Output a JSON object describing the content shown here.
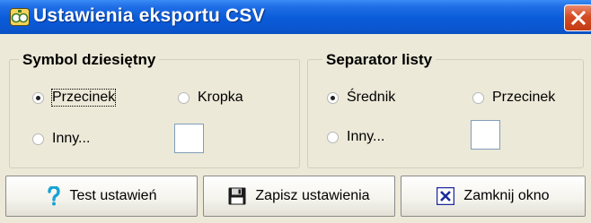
{
  "window": {
    "title": "Ustawienia eksportu CSV"
  },
  "decimal_group": {
    "legend": "Symbol dziesiętny",
    "options": [
      "Przecinek",
      "Kropka",
      "Inny..."
    ],
    "selected": "Przecinek"
  },
  "separator_group": {
    "legend": "Separator listy",
    "options": [
      "Średnik",
      "Przecinek",
      "Inny..."
    ],
    "selected": "Średnik"
  },
  "buttons": {
    "test_label": "Test ustawień",
    "save_label": "Zapisz ustawienia",
    "close_label": "Zamknij okno"
  },
  "icons": {
    "app": "app-icon",
    "test": "question-mark-icon",
    "save": "floppy-disk-icon",
    "close_window": "close-x-icon",
    "titlebar_close": "close-icon"
  },
  "colors": {
    "titlebar": "#0a5bd9",
    "close_button": "#d64b24",
    "dialog_background": "#ece9d8",
    "test_icon": "#16a3d6"
  }
}
